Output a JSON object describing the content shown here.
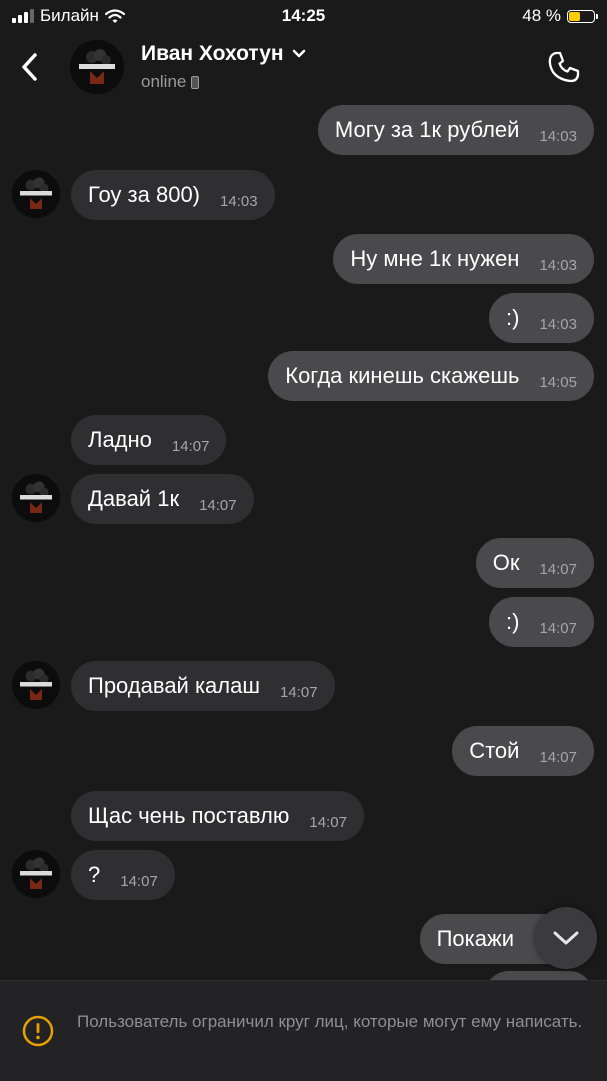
{
  "status_bar": {
    "carrier": "Билайн",
    "time": "14:25",
    "battery": "48 %",
    "battery_level": 0.48
  },
  "header": {
    "contact_name": "Иван Хохотун",
    "status": "online"
  },
  "messages": [
    {
      "dir": "out",
      "text": "Могу за 1к рублей",
      "time": "14:03"
    },
    {
      "dir": "in",
      "text": "Гоу за 800)",
      "time": "14:03"
    },
    {
      "dir": "out",
      "text": "Ну мне 1к нужен",
      "time": "14:03"
    },
    {
      "dir": "out",
      "text": ":)",
      "time": "14:03"
    },
    {
      "dir": "out",
      "text": "Когда кинешь скажешь",
      "time": "14:05"
    },
    {
      "dir": "in",
      "text": "Ладно",
      "time": "14:07"
    },
    {
      "dir": "in",
      "text": "Давай 1к",
      "time": "14:07"
    },
    {
      "dir": "out",
      "text": "Ок",
      "time": "14:07"
    },
    {
      "dir": "out",
      "text": ":)",
      "time": "14:07"
    },
    {
      "dir": "in",
      "text": "Продавай калаш",
      "time": "14:07"
    },
    {
      "dir": "out",
      "text": "Стой",
      "time": "14:07"
    },
    {
      "dir": "in",
      "text": "Щас чень поставлю",
      "time": "14:07"
    },
    {
      "dir": "in",
      "text": "?",
      "time": "14:07"
    },
    {
      "dir": "out",
      "text": "Покажи",
      "time": ""
    }
  ],
  "footer": {
    "notice": "Пользователь ограничил круг лиц, которые могут ему написать."
  }
}
